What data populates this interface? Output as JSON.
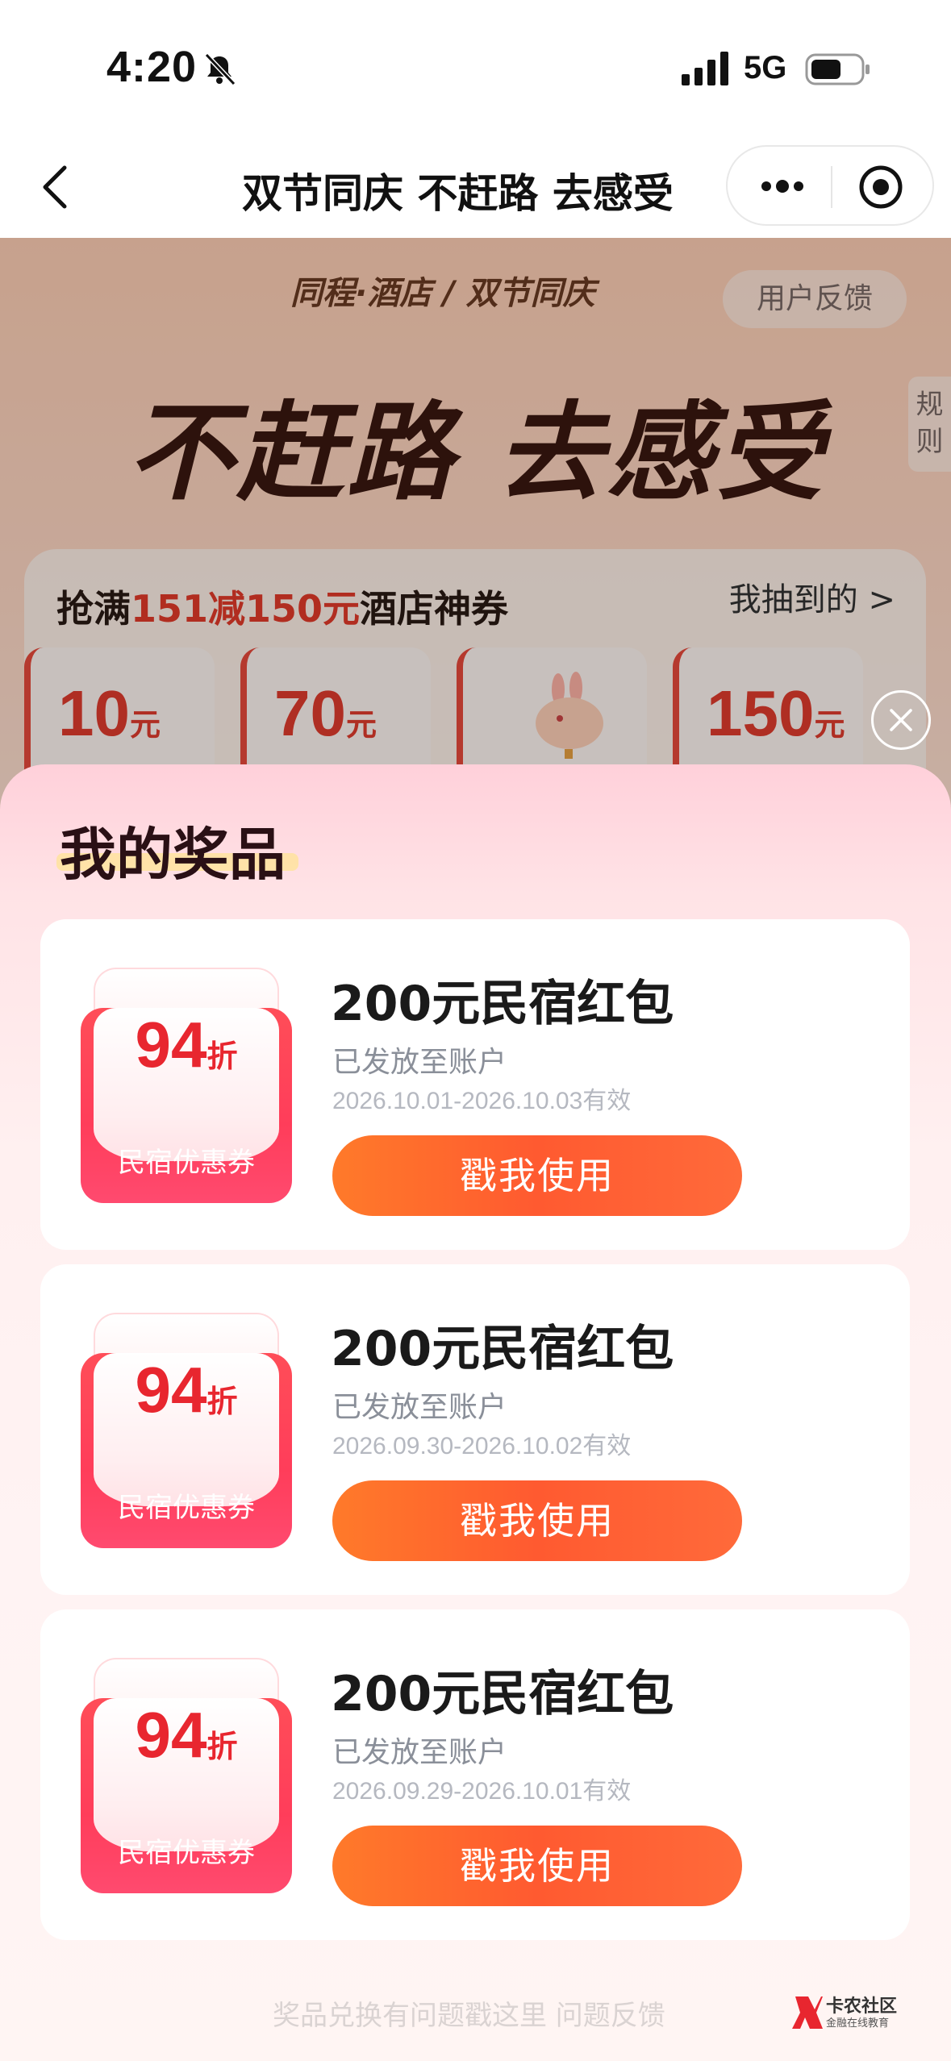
{
  "status_bar": {
    "time": "4:20",
    "network": "5G"
  },
  "nav": {
    "title": "双节同庆 不赶路 去感受"
  },
  "background": {
    "brand": "同程·酒店 / 双节同庆",
    "feedback": "用户反馈",
    "rules": "规则",
    "headline": "不赶路 去感受",
    "panel_title_prefix": "抢满",
    "panel_title_red": "151减150元",
    "panel_title_suffix": "酒店神券",
    "panel_link": "我抽到的 >",
    "mini_coupons": [
      {
        "amount": "10",
        "unit": "元"
      },
      {
        "amount": "70",
        "unit": "元"
      },
      {
        "amount": "150",
        "unit": "元"
      }
    ]
  },
  "sheet": {
    "title": "我的奖品",
    "prizes": [
      {
        "discount": "94",
        "discount_unit": "折",
        "coupon_label": "民宿优惠券",
        "name": "200元民宿红包",
        "status": "已发放至账户",
        "validity": "2026.10.01-2026.10.03有效",
        "button": "戳我使用"
      },
      {
        "discount": "94",
        "discount_unit": "折",
        "coupon_label": "民宿优惠券",
        "name": "200元民宿红包",
        "status": "已发放至账户",
        "validity": "2026.09.30-2026.10.02有效",
        "button": "戳我使用"
      },
      {
        "discount": "94",
        "discount_unit": "折",
        "coupon_label": "民宿优惠券",
        "name": "200元民宿红包",
        "status": "已发放至账户",
        "validity": "2026.09.29-2026.10.01有效",
        "button": "戳我使用"
      }
    ],
    "footer_help": "奖品兑换有问题戳这里    问题反馈"
  },
  "watermark": {
    "title": "卡农社区",
    "subtitle": "金融在线教育"
  },
  "colors": {
    "accent_red": "#e8262f",
    "button_orange": "#ff6a30",
    "sheet_pink": "#ffe3e6"
  }
}
